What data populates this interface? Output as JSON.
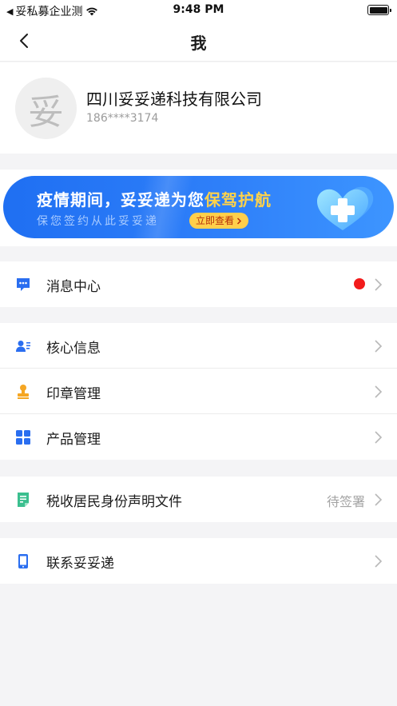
{
  "status_bar": {
    "carrier": "妥私募企业测",
    "time": "9:48 PM"
  },
  "nav": {
    "title": "我"
  },
  "profile": {
    "avatar_text": "妥",
    "company": "四川妥妥递科技有限公司",
    "phone": "186****3174"
  },
  "banner": {
    "title_main": "疫情期间，妥妥递为您",
    "title_highlight": "保驾护航",
    "subtitle": "保您签约从此妥妥递",
    "button_label": "立即查看"
  },
  "menu": {
    "message_center": "消息中心",
    "core_info": "核心信息",
    "seal_management": "印章管理",
    "product_management": "产品管理",
    "tax_declaration": "税收居民身份声明文件",
    "tax_status": "待签署",
    "contact": "联系妥妥递"
  },
  "colors": {
    "accent": "#2a6ef0",
    "seal_icon": "#f5a623",
    "doc_icon": "#3bbf8f",
    "badge": "#f21b1b",
    "banner_highlight": "#ffd24a"
  }
}
